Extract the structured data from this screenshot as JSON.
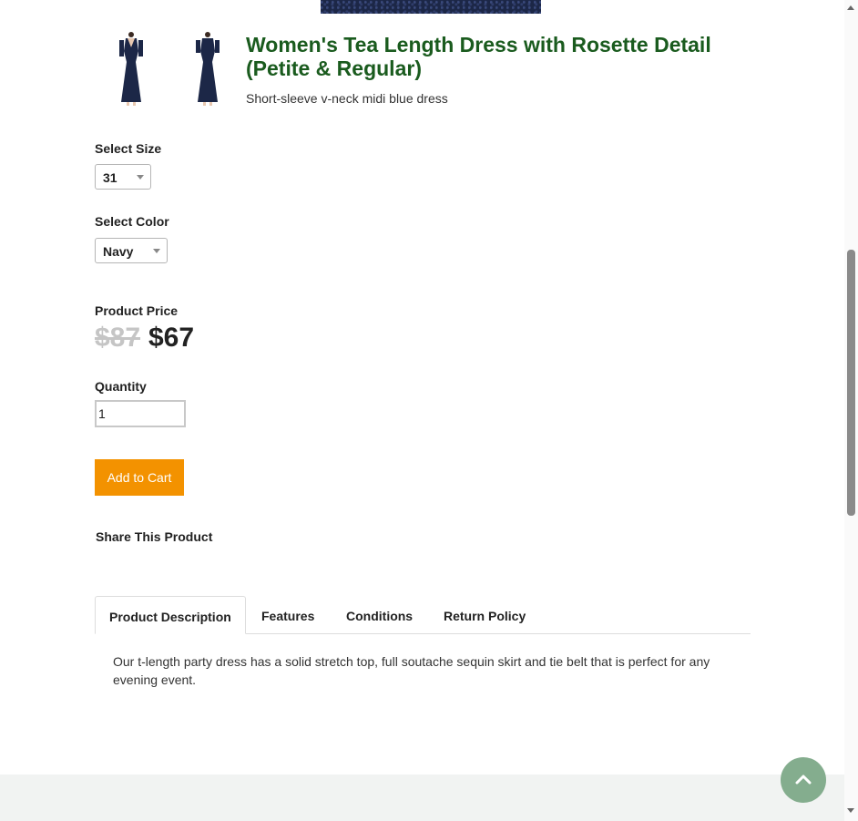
{
  "product": {
    "title": "Women's Tea Length Dress with Rosette Detail (Petite & Regular)",
    "subtitle": "Short-sleeve v-neck midi blue dress",
    "size": {
      "label": "Select Size",
      "selected": "31"
    },
    "color": {
      "label": "Select Color",
      "selected": "Navy"
    },
    "price": {
      "label": "Product Price",
      "old": "$87",
      "new": "$67"
    },
    "quantity": {
      "label": "Quantity",
      "value": "1"
    },
    "add_to_cart": "Add to Cart",
    "share_label": "Share This Product"
  },
  "tabs": [
    {
      "label": "Product Description"
    },
    {
      "label": "Features"
    },
    {
      "label": "Conditions"
    },
    {
      "label": "Return Policy"
    }
  ],
  "description": "Our t-length party dress has a solid stretch top, full soutache sequin skirt and tie belt that is perfect for any evening event.",
  "colors": {
    "title_green": "#1a5b1e",
    "button_orange": "#f39200",
    "back_to_top": "#84ad8e",
    "dress_navy": "#1c2747"
  },
  "icons": {
    "back_to_top": "chevron-up-icon",
    "dropdown": "caret-down-icon"
  }
}
